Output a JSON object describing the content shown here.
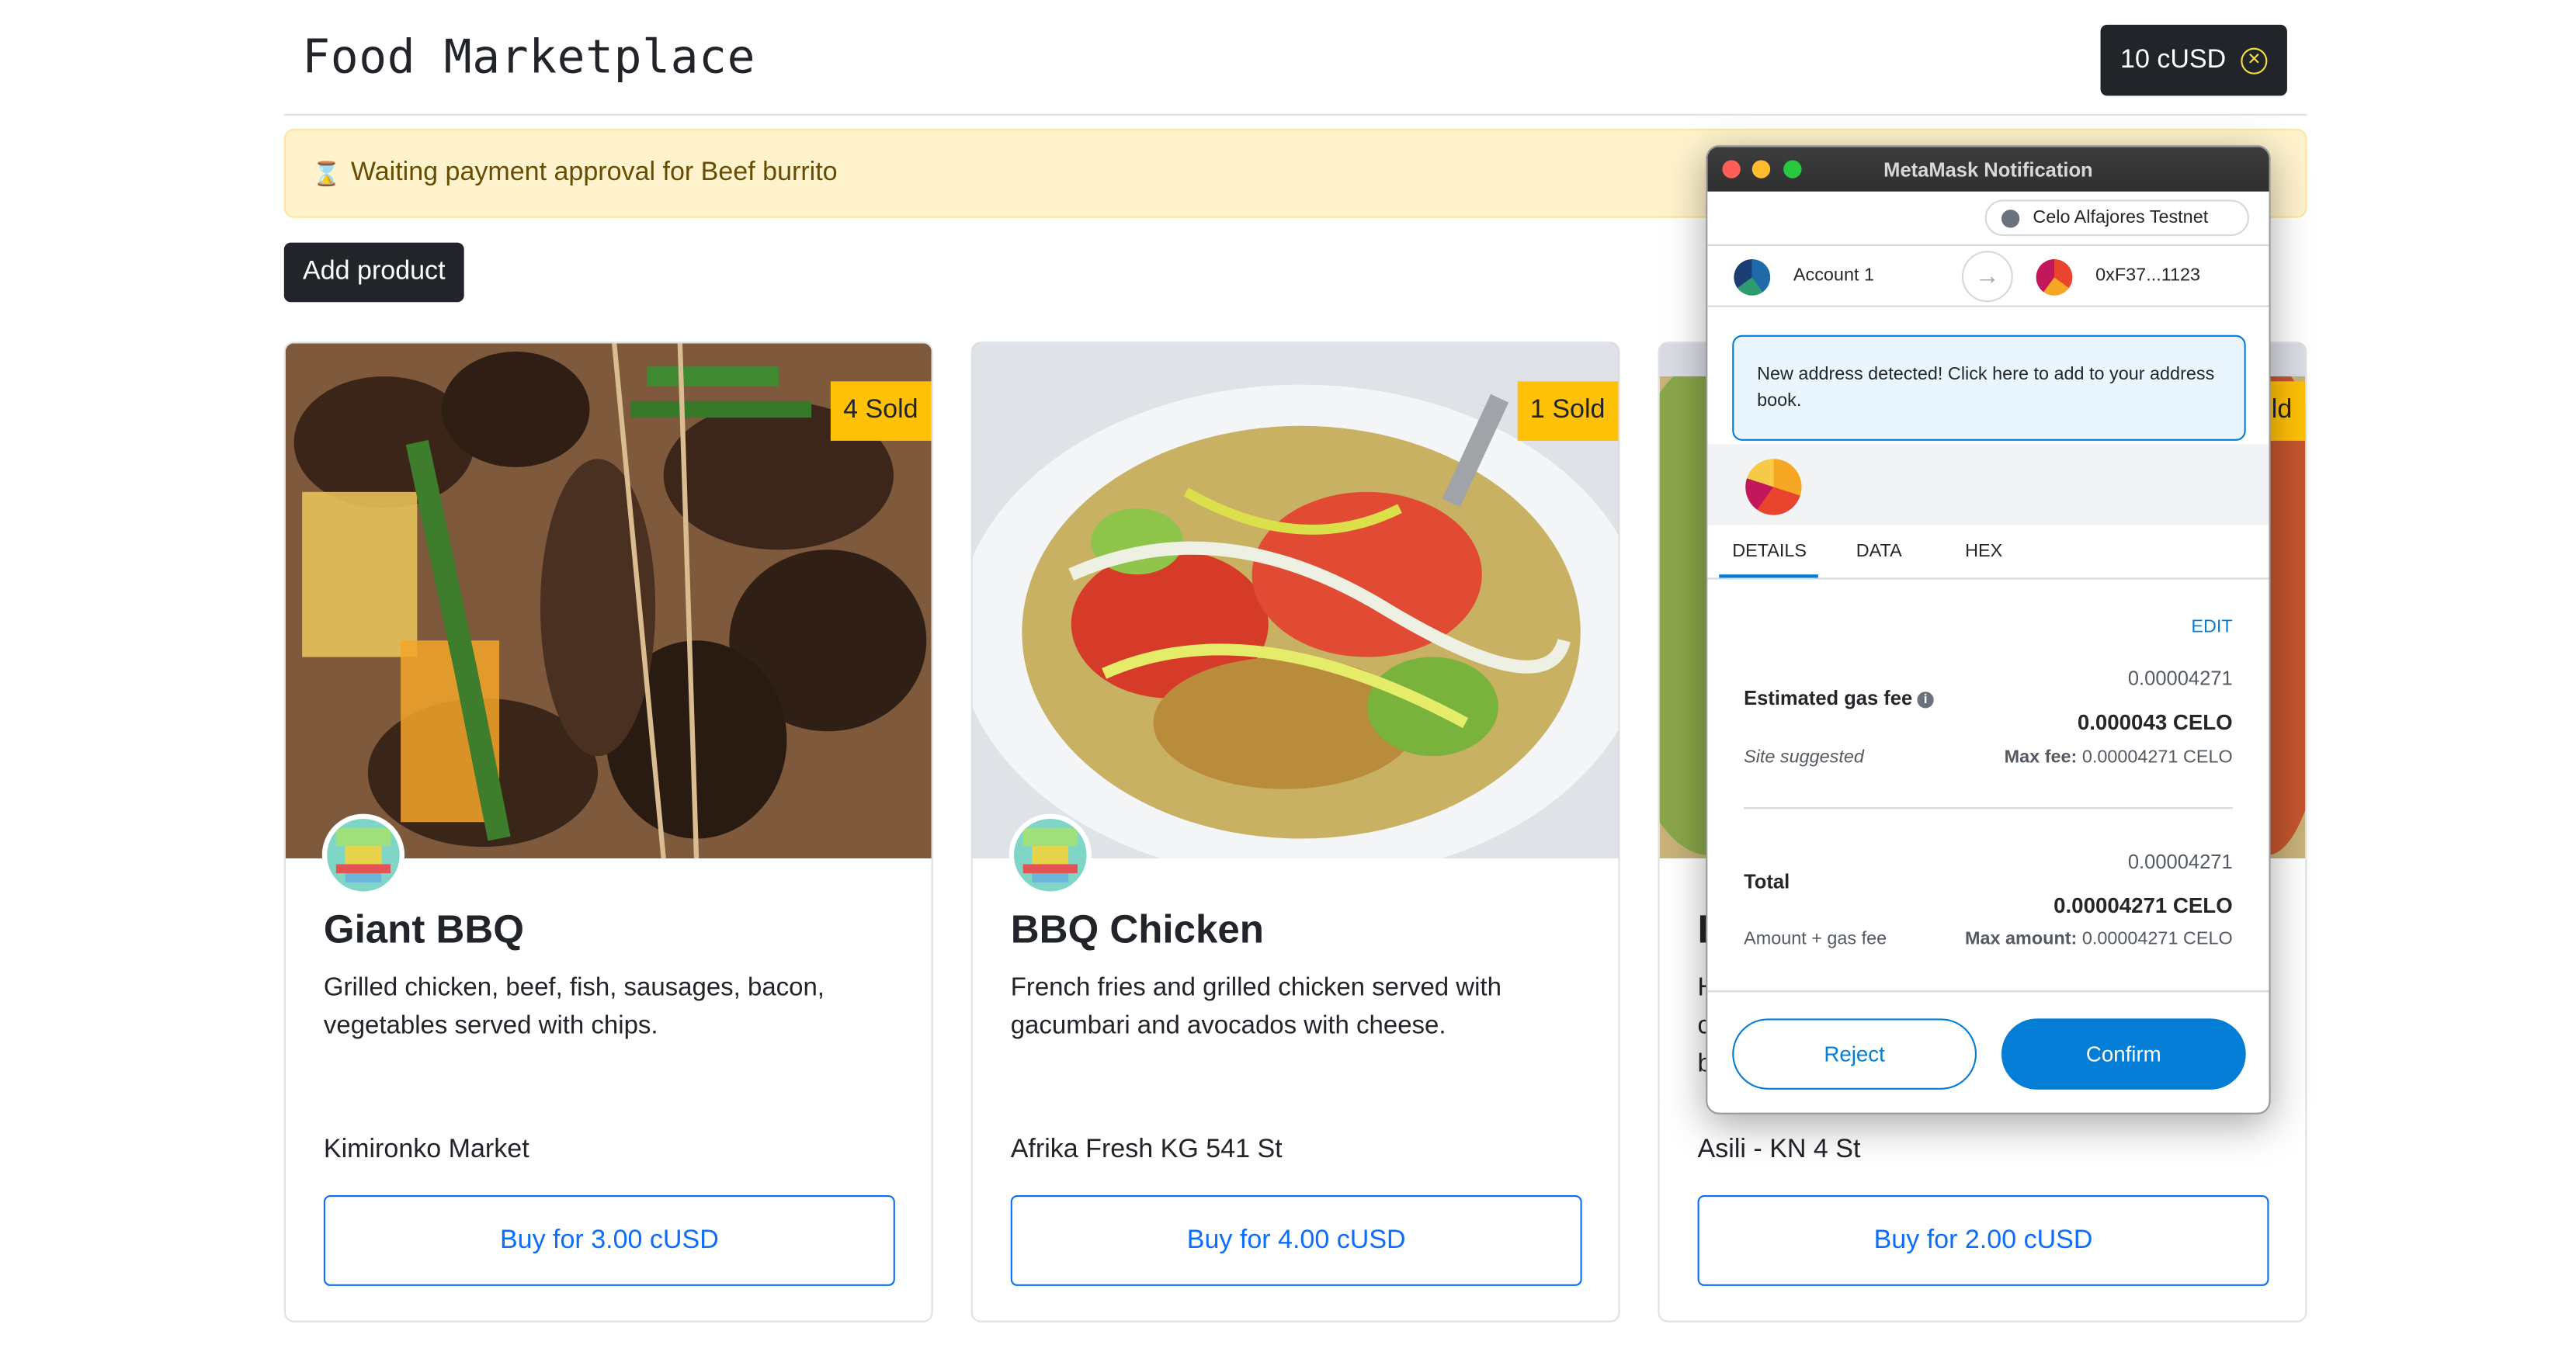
{
  "header": {
    "title": "Food Marketplace",
    "balance": "10 cUSD",
    "balance_icon": "close-circle-icon"
  },
  "alert": {
    "icon": "⌛",
    "text": "Waiting payment approval for Beef burrito"
  },
  "add_product_label": "Add product",
  "products": [
    {
      "sold": "4 Sold",
      "name": "Giant BBQ",
      "description": "Grilled chicken, beef, fish, sausages, bacon, vegetables served with chips.",
      "location": "Kimironko Market",
      "buy_label": "Buy for 3.00 cUSD"
    },
    {
      "sold": "1 Sold",
      "name": "BBQ Chicken",
      "description": "French fries and grilled chicken served with gacumbari and avocados with cheese.",
      "location": "Afrika Fresh KG 541 St",
      "buy_label": "Buy for 4.00 cUSD"
    },
    {
      "sold": "ld",
      "name": "E",
      "description": "H\nc\nb",
      "location": "Asili - KN 4 St",
      "buy_label": "Buy for 2.00 cUSD"
    }
  ],
  "metamask": {
    "window_title": "MetaMask Notification",
    "network": "Celo Alfajores Testnet",
    "from_account": "Account 1",
    "to_address": "0xF37...1123",
    "notice": "New address detected! Click here to add to your address book.",
    "tabs": [
      "DETAILS",
      "DATA",
      "HEX"
    ],
    "edit_label": "EDIT",
    "gas": {
      "label": "Estimated gas fee",
      "value_small": "0.00004271",
      "value_main": "0.000043 CELO",
      "sub_label": "Site suggested",
      "max_label": "Max fee:",
      "max_value": "0.00004271 CELO"
    },
    "total": {
      "label": "Total",
      "value_small": "0.00004271",
      "value_main": "0.00004271 CELO",
      "sub_label": "Amount + gas fee",
      "max_label": "Max amount:",
      "max_value": "0.00004271 CELO"
    },
    "reject_label": "Reject",
    "confirm_label": "Confirm"
  }
}
